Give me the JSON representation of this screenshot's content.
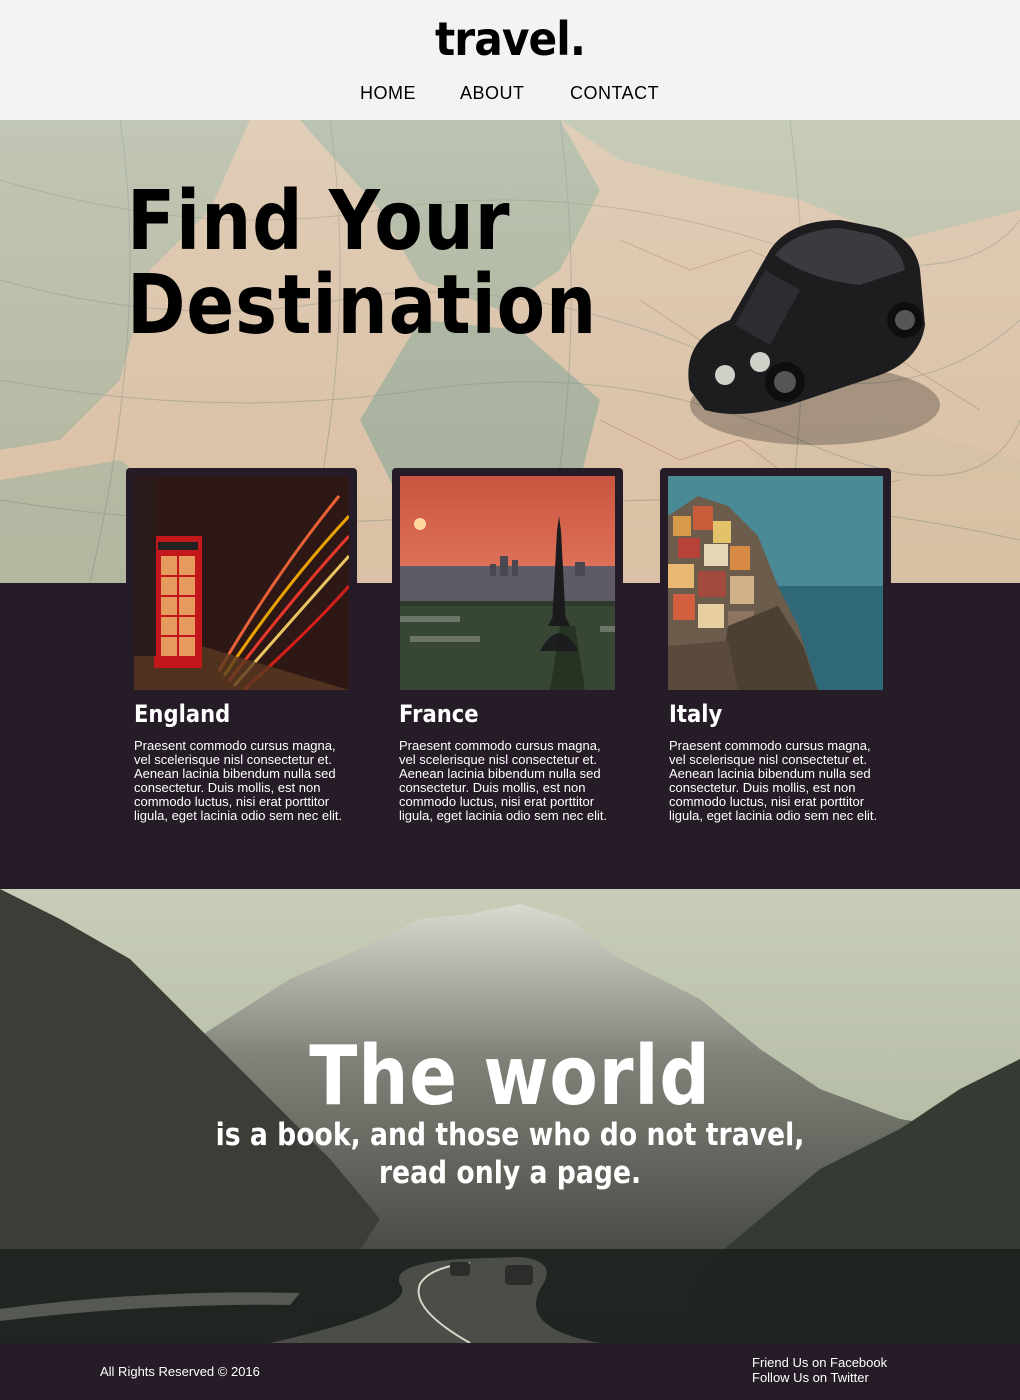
{
  "header": {
    "logo": "travel.",
    "nav": [
      {
        "label": "HOME"
      },
      {
        "label": "ABOUT"
      },
      {
        "label": "CONTACT"
      }
    ]
  },
  "hero": {
    "title_line1": "Find Your",
    "title_line2": "Destination"
  },
  "destinations": [
    {
      "name": "England",
      "text": "Praesent commodo cursus magna, vel scelerisque nisl consectetur et. Aenean lacinia bibendum nulla sed consectetur. Duis mollis, est non commodo luctus, nisi erat porttitor ligula, eget lacinia odio sem nec elit."
    },
    {
      "name": "France",
      "text": "Praesent commodo cursus magna, vel scelerisque nisl consectetur et. Aenean lacinia bibendum nulla sed consectetur. Duis mollis, est non commodo luctus, nisi erat porttitor ligula, eget lacinia odio sem nec elit."
    },
    {
      "name": "Italy",
      "text": "Praesent commodo cursus magna, vel scelerisque nisl consectetur et. Aenean lacinia bibendum nulla sed consectetur. Duis mollis, est non commodo luctus, nisi erat porttitor ligula, eget lacinia odio sem nec elit."
    }
  ],
  "quote": {
    "big": "The world",
    "line1": "is a book, and those who do not travel,",
    "line2": "read only a page."
  },
  "footer": {
    "copyright": "All Rights Reserved © 2016",
    "facebook": "Friend Us on Facebook",
    "twitter": "Follow Us on Twitter"
  },
  "colors": {
    "header_bg": "#f3f3f3",
    "dark_band": "#261c27",
    "text_light": "#ffffff",
    "text_dark": "#000000"
  }
}
